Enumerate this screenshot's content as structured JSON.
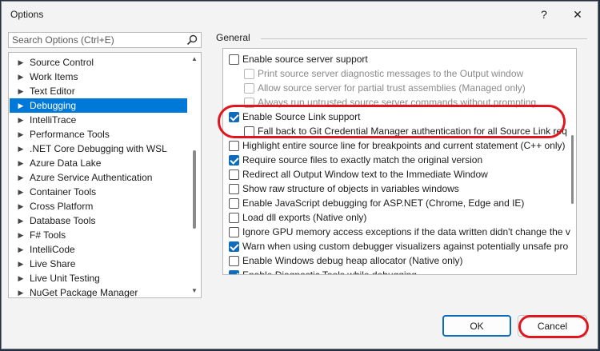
{
  "window": {
    "title": "Options",
    "help_glyph": "?",
    "close_glyph": "✕"
  },
  "search": {
    "placeholder": "Search Options (Ctrl+E)",
    "value": ""
  },
  "tree": {
    "items": [
      {
        "label": "Source Control"
      },
      {
        "label": "Work Items"
      },
      {
        "label": "Text Editor"
      },
      {
        "label": "Debugging",
        "selected": true
      },
      {
        "label": "IntelliTrace"
      },
      {
        "label": "Performance Tools"
      },
      {
        "label": ".NET Core Debugging with WSL"
      },
      {
        "label": "Azure Data Lake"
      },
      {
        "label": "Azure Service Authentication"
      },
      {
        "label": "Container Tools"
      },
      {
        "label": "Cross Platform"
      },
      {
        "label": "Database Tools"
      },
      {
        "label": "F# Tools"
      },
      {
        "label": "IntelliCode"
      },
      {
        "label": "Live Share"
      },
      {
        "label": "Live Unit Testing"
      },
      {
        "label": "NuGet Package Manager"
      }
    ]
  },
  "group": {
    "label": "General"
  },
  "options": [
    {
      "label": "Enable source server support",
      "checked": false,
      "disabled": false,
      "indent": 0
    },
    {
      "label": "Print source server diagnostic messages to the Output window",
      "checked": false,
      "disabled": true,
      "indent": 1
    },
    {
      "label": "Allow source server for partial trust assemblies (Managed only)",
      "checked": false,
      "disabled": true,
      "indent": 1
    },
    {
      "label": "Always run untrusted source server commands without prompting",
      "checked": false,
      "disabled": true,
      "indent": 1
    },
    {
      "label": "Enable Source Link support",
      "checked": true,
      "disabled": false,
      "indent": 0
    },
    {
      "label": "Fall back to Git Credential Manager authentication for all Source Link req",
      "checked": false,
      "disabled": false,
      "indent": 1
    },
    {
      "label": "Highlight entire source line for breakpoints and current statement (C++ only)",
      "checked": false,
      "disabled": false,
      "indent": 0
    },
    {
      "label": "Require source files to exactly match the original version",
      "checked": true,
      "disabled": false,
      "indent": 0
    },
    {
      "label": "Redirect all Output Window text to the Immediate Window",
      "checked": false,
      "disabled": false,
      "indent": 0
    },
    {
      "label": "Show raw structure of objects in variables windows",
      "checked": false,
      "disabled": false,
      "indent": 0
    },
    {
      "label": "Enable JavaScript debugging for ASP.NET (Chrome, Edge and IE)",
      "checked": false,
      "disabled": false,
      "indent": 0
    },
    {
      "label": "Load dll exports (Native only)",
      "checked": false,
      "disabled": false,
      "indent": 0
    },
    {
      "label": "Ignore GPU memory access exceptions if the data written didn't change the v",
      "checked": false,
      "disabled": false,
      "indent": 0
    },
    {
      "label": "Warn when using custom debugger visualizers against potentially unsafe pro",
      "checked": true,
      "disabled": false,
      "indent": 0
    },
    {
      "label": "Enable Windows debug heap allocator (Native only)",
      "checked": false,
      "disabled": false,
      "indent": 0
    },
    {
      "label": "Enable Diagnostic Tools while debugging",
      "checked": true,
      "disabled": false,
      "indent": 0
    }
  ],
  "buttons": {
    "ok": "OK",
    "cancel": "Cancel"
  },
  "colors": {
    "accent": "#0078d7",
    "annotation": "#e0161e"
  }
}
